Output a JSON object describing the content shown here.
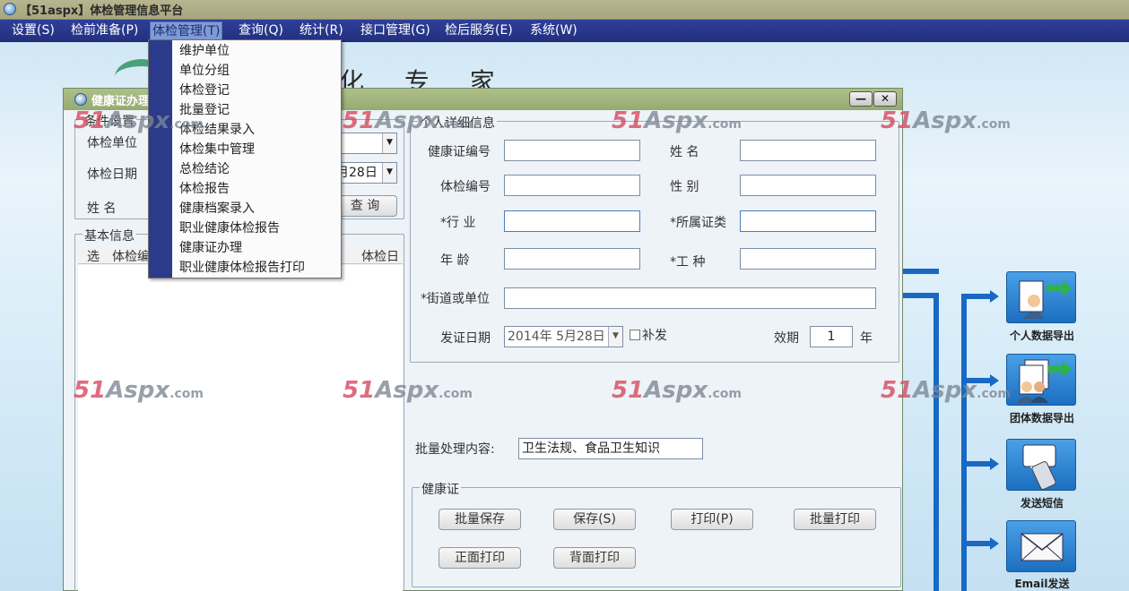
{
  "app": {
    "title": "【51aspx】体检管理信息平台"
  },
  "menubar": {
    "items": [
      {
        "label": "设置(S)",
        "active": false
      },
      {
        "label": "检前准备(P)",
        "active": false
      },
      {
        "label": "体检管理(T)",
        "active": true
      },
      {
        "label": "查询(Q)",
        "active": false
      },
      {
        "label": "统计(R)",
        "active": false
      },
      {
        "label": "接口管理(G)",
        "active": false
      },
      {
        "label": "检后服务(E)",
        "active": false
      },
      {
        "label": "系统(W)",
        "active": false
      }
    ]
  },
  "dropdown": {
    "items": [
      "维护单位",
      "单位分组",
      "体检登记",
      "批量登记",
      "体检结果录入",
      "体检集中管理",
      "总检结论",
      "体检报告",
      "健康档案录入",
      "职业健康体检报告",
      "健康证办理",
      "职业健康体检报告打印"
    ]
  },
  "background": {
    "header_text": "化 专 家"
  },
  "dialog": {
    "title": "健康证办理",
    "minimize": "—",
    "close": "✕",
    "conditions": {
      "legend": "条件设置",
      "unit_label": "体检单位",
      "date_label": "体检日期",
      "date_value": "月28日",
      "name_label": "姓    名",
      "query_button": "查 询"
    },
    "basic_info": {
      "legend": "基本信息",
      "columns": [
        "选",
        "体检编",
        "体检日"
      ]
    },
    "personal": {
      "legend": "个人详细信息",
      "cert_no_label": "健康证编号",
      "name_label": "姓    名",
      "exam_no_label": "体检编号",
      "gender_label": "性    别",
      "industry_label": "*行    业",
      "cert_type_label": "*所属证类",
      "age_label": "年    龄",
      "job_label": "*工    种",
      "street_label": "*街道或单位",
      "issue_date_label": "发证日期",
      "issue_date_value": "2014年 5月28日",
      "reissue_label": "补发",
      "validity_label": "效期",
      "validity_value": "1",
      "validity_unit": "年"
    },
    "batch": {
      "label": "批量处理内容:",
      "value": "卫生法规、食品卫生知识"
    },
    "health_cert": {
      "legend": "健康证",
      "batch_save": "批量保存",
      "save": "保存(S)",
      "print": "打印(P)",
      "batch_print": "批量打印",
      "front_print": "正面打印",
      "back_print": "背面打印"
    }
  },
  "flow": {
    "tiles": [
      {
        "caption": "个人数据导出",
        "icon": "person-export-icon"
      },
      {
        "caption": "团体数据导出",
        "icon": "group-export-icon"
      },
      {
        "caption": "发送短信",
        "icon": "sms-icon"
      },
      {
        "caption": "Email发送",
        "icon": "email-icon"
      }
    ]
  },
  "watermark": {
    "num": "51",
    "word": "Aspx",
    "suffix": ".com"
  },
  "colors": {
    "menubar": "#2e3f9a",
    "menu_active": "#7f9bd6",
    "dialog_title": "#97aa72",
    "flow_blue": "#1769c4",
    "watermark_red": "#d6455a"
  }
}
